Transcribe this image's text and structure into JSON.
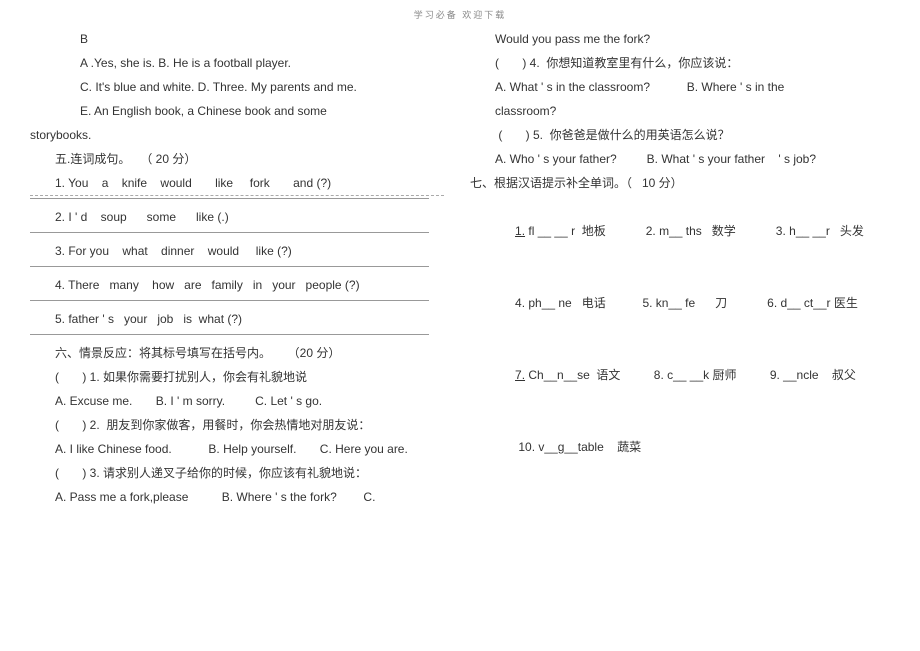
{
  "header": "学习必备        欢迎下载",
  "left": {
    "l1": "B",
    "l2": "A .Yes, she is. B. He is a football player.",
    "l3": "C. It's blue and white. D. Three. My parents and me.",
    "l4": "E. An English book, a Chinese book and some",
    "l5": "storybooks.",
    "sec5_title": "五.连词成句。   （ 20 分）",
    "q1": "1. You    a    knife    would       like     fork       and (?)",
    "q2": "2. I ' d    soup      some      like (.)",
    "q3": "3. For you    what    dinner    would     like (?)",
    "q4": "4. There   many    how   are   family   in   your   people (?)",
    "q5": "5. father ' s   your   job   is  what (?)",
    "sec6_title": "六、情景反应：将其标号填写在括号内。     （20 分）",
    "s6q1": "(       ) 1. 如果你需要打扰别人，你会有礼貌地说",
    "s6q1_opts": "A. Excuse me.       B. I ' m sorry.         C. Let ' s go.",
    "s6q2": "(       ) 2.  朋友到你家做客，用餐时，你会热情地对朋友说：",
    "s6q2_opts": "A. I like Chinese food.           B. Help yourself.       C. Here you are.",
    "s6q3": "(       ) 3. 请求别人递叉子给你的时候，你应该有礼貌地说：",
    "s6q3_opts": "A. Pass me a fork,please          B. Where ' s the fork?        C."
  },
  "right": {
    "r1": "Would you pass me the fork?",
    "r2": "(       ) 4.  你想知道教室里有什么，你应该说：",
    "r3": "A. What ' s in the classroom?           B. Where ' s in the",
    "r3b": "classroom?",
    "r4": " (       ) 5.  你爸爸是做什么的用英语怎么说？",
    "r5": "A. Who ' s your father?         B. What ' s your father    ' s job?",
    "sec7_title": "七、根据汉语提示补全单词。（   10 分）",
    "w1": "1.",
    "w1b": " fl __ __ r  地板",
    "w2": "2. m__ ths   数学",
    "w3": "3. h__ __r   头发",
    "w4": "4. ph__ ne   电话",
    "w5": "5. kn__ fe      刀",
    "w6": "6. d__ ct__r 医生",
    "w7": "7.",
    "w7b": " Ch__n__se  语文",
    "w8": "8. c__ __k 厨师",
    "w9": "9. __ncle    叔父",
    "w10": " 10. v__g__table    蔬菜"
  }
}
